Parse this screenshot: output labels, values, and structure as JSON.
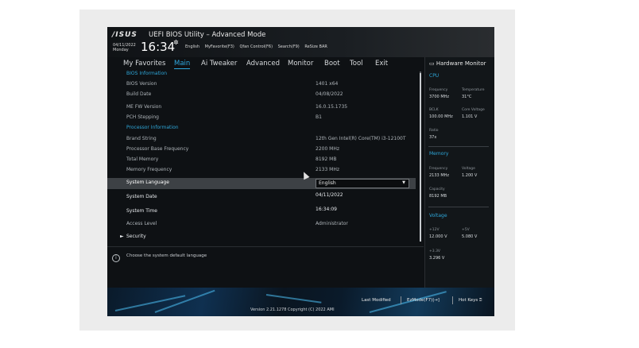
{
  "header": {
    "logo": "/ISUS",
    "title": "UEFI BIOS Utility – Advanced Mode",
    "date": "04/11/2022",
    "day": "Monday",
    "time": "16:34",
    "toolbar": [
      "English",
      "MyFavorite(F3)",
      "Qfan Control(F6)",
      "Search(F9)",
      "ReSize BAR"
    ]
  },
  "menu": [
    "My Favorites",
    "Main",
    "Ai Tweaker",
    "Advanced",
    "Monitor",
    "Boot",
    "Tool",
    "Exit"
  ],
  "menu_active": "Main",
  "main": {
    "bios_info_header": "BIOS Information",
    "bios_version_label": "BIOS Version",
    "bios_version": "1401  x64",
    "build_date_label": "Build Date",
    "build_date": "04/08/2022",
    "me_fw_label": "ME FW Version",
    "me_fw": "16.0.15.1735",
    "pch_label": "PCH Stepping",
    "pch": "B1",
    "proc_info_header": "Processor Information",
    "brand_label": "Brand String",
    "brand": "12th Gen Intel(R) Core(TM) i3-12100T",
    "base_freq_label": "Processor Base Frequency",
    "base_freq": "2200 MHz",
    "total_mem_label": "Total Memory",
    "total_mem": "8192 MB",
    "mem_freq_label": "Memory Frequency",
    "mem_freq": "2133 MHz",
    "sys_lang_label": "System Language",
    "sys_lang": "English",
    "sys_date_label": "System Date",
    "sys_date": "04/11/2022",
    "sys_time_label": "System Time",
    "sys_time": "16:34:09",
    "access_label": "Access Level",
    "access": "Administrator",
    "security_label": "Security"
  },
  "help": {
    "text": "Choose the system default language"
  },
  "hardware": {
    "title": "Hardware Monitor",
    "cpu_header": "CPU",
    "freq_label": "Frequency",
    "freq": "3700 MHz",
    "temp_label": "Temperature",
    "temp": "31°C",
    "bclk_label": "BCLK",
    "bclk": "100.00 MHz",
    "corev_label": "Core Voltage",
    "corev": "1.101 V",
    "ratio_label": "Ratio",
    "ratio": "37x",
    "mem_header": "Memory",
    "mfreq_label": "Frequency",
    "mfreq": "2133 MHz",
    "mvolt_label": "Voltage",
    "mvolt": "1.200 V",
    "cap_label": "Capacity",
    "cap": "8192 MB",
    "volt_header": "Voltage",
    "v12_label": "+12V",
    "v12": "12.000 V",
    "v5_label": "+5V",
    "v5": "5.080 V",
    "v33_label": "+3.3V",
    "v33": "3.296 V"
  },
  "footer": {
    "last_modified": "Last Modified",
    "ezmode": "EzMode(F7)|→]",
    "hotkeys": "Hot Keys",
    "version": "Version 2.21.1278 Copyright (C) 2022 AMI"
  },
  "colors": {
    "accent": "#2ea6d8",
    "highlight_row": "#3d4145",
    "background": "#0e1114"
  }
}
